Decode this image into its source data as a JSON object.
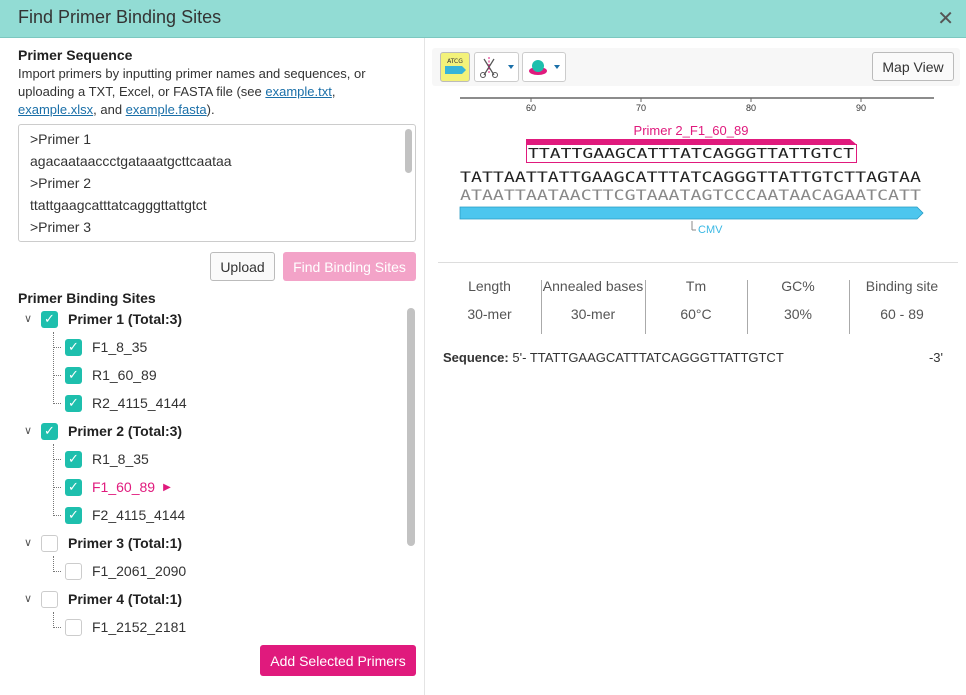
{
  "dialog": {
    "title": "Find Primer Binding Sites",
    "close_glyph": "✕"
  },
  "primer_sequence": {
    "heading": "Primer Sequence",
    "help_pre": "Import primers by inputting primer names and sequences, or uploading a TXT, Excel, or FASTA file (see ",
    "link_txt": "example.txt",
    "sep1": ", ",
    "link_xlsx": "example.xlsx",
    "sep2": ", and ",
    "link_fasta": "example.fasta",
    "help_post": ").",
    "lines": [
      ">Primer 1",
      "agacaataaccctgataaatgcttcaataa",
      ">Primer 2",
      "ttattgaagcatttatcagggttattgtct",
      ">Primer 3"
    ]
  },
  "buttons": {
    "upload": "Upload",
    "find": "Find Binding Sites",
    "add": "Add Selected Primers",
    "map_view": "Map View"
  },
  "binding_sites": {
    "heading": "Primer Binding Sites",
    "groups": [
      {
        "label": "Primer 1 (Total:3)",
        "checked": true,
        "children": [
          {
            "label": "F1_8_35",
            "checked": true
          },
          {
            "label": "R1_60_89",
            "checked": true
          },
          {
            "label": "R2_4115_4144",
            "checked": true
          }
        ]
      },
      {
        "label": "Primer 2 (Total:3)",
        "checked": true,
        "children": [
          {
            "label": "R1_8_35",
            "checked": true
          },
          {
            "label": "F1_60_89",
            "checked": true,
            "selected": true
          },
          {
            "label": "F2_4115_4144",
            "checked": true
          }
        ]
      },
      {
        "label": "Primer 3 (Total:1)",
        "checked": false,
        "children": [
          {
            "label": "F1_2061_2090",
            "checked": false
          }
        ]
      },
      {
        "label": "Primer 4 (Total:1)",
        "checked": false,
        "children": [
          {
            "label": "F1_2152_2181",
            "checked": false
          }
        ]
      }
    ]
  },
  "toolbar": {
    "icons": [
      "atcg-sequence-icon",
      "scissors-enzyme-icon",
      "feature-blob-icon"
    ],
    "atcg_text": "ATCG"
  },
  "sequence_view": {
    "ruler_ticks": [
      "60",
      "70",
      "80",
      "90"
    ],
    "primer_label": "Primer 2_F1_60_89",
    "primer_seq": "TTATTGAAGCATTTATCAGGGTTATTGTCT",
    "top_strand": "TATTAATTATTGAAGCATTTATCAGGGTTATTGTCTTAGTAA",
    "bottom_strand": "ATAATTAATAACTTCGTAAATAGTCCCAATAACAGAATCATT",
    "feature_label": "CMV"
  },
  "stats": {
    "headers": [
      "Length",
      "Annealed bases",
      "Tm",
      "GC%",
      "Binding site"
    ],
    "values": [
      "30-mer",
      "30-mer",
      "60°C",
      "30%",
      "60 - 89"
    ]
  },
  "sequence_info": {
    "label": "Sequence:",
    "prefix": "5'-",
    "seq": "TTATTGAAGCATTTATCAGGGTTATTGTCT",
    "suffix": "-3'"
  },
  "colors": {
    "header": "#92dcd4",
    "accent": "#e01a7d",
    "check": "#1ebfad",
    "feature": "#4cc6ee"
  }
}
